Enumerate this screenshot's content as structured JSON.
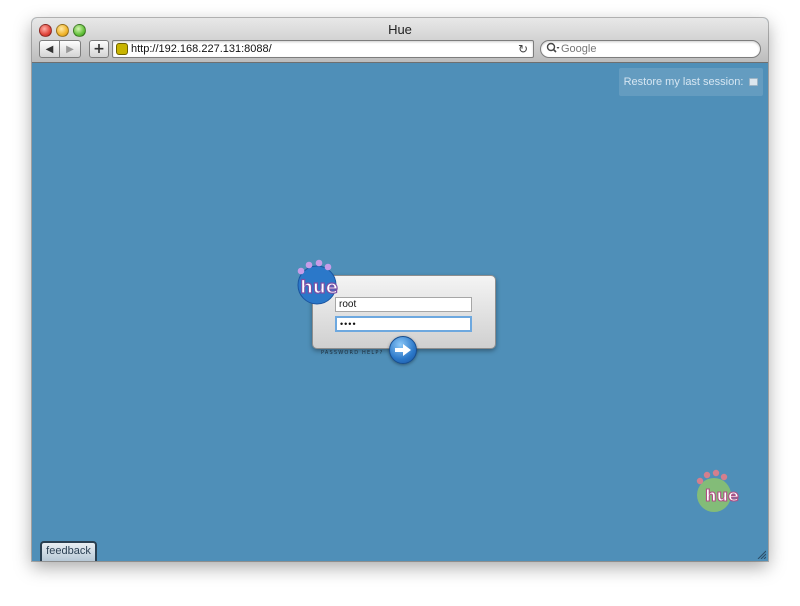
{
  "window": {
    "title": "Hue"
  },
  "toolbar": {
    "back_icon": "◀",
    "forward_icon": "▶",
    "add_icon": "+",
    "url": "http://192.168.227.131:8088/",
    "reload_icon": "↻",
    "search_placeholder": "Google",
    "search_icon": "search-icon"
  },
  "page": {
    "restore_session_label": "Restore my last session:",
    "login": {
      "username_value": "root",
      "password_value": "••••",
      "password_help": "PASSWORD HELP?",
      "submit_icon": "arrow-right-icon"
    },
    "logo_text": "hue",
    "feedback_label": "feedback"
  },
  "colors": {
    "background": "#4f8fb8",
    "logo_blue": "#2b78c9",
    "logo_purple": "#7b4fa6",
    "logo_green": "#8cc46c"
  }
}
